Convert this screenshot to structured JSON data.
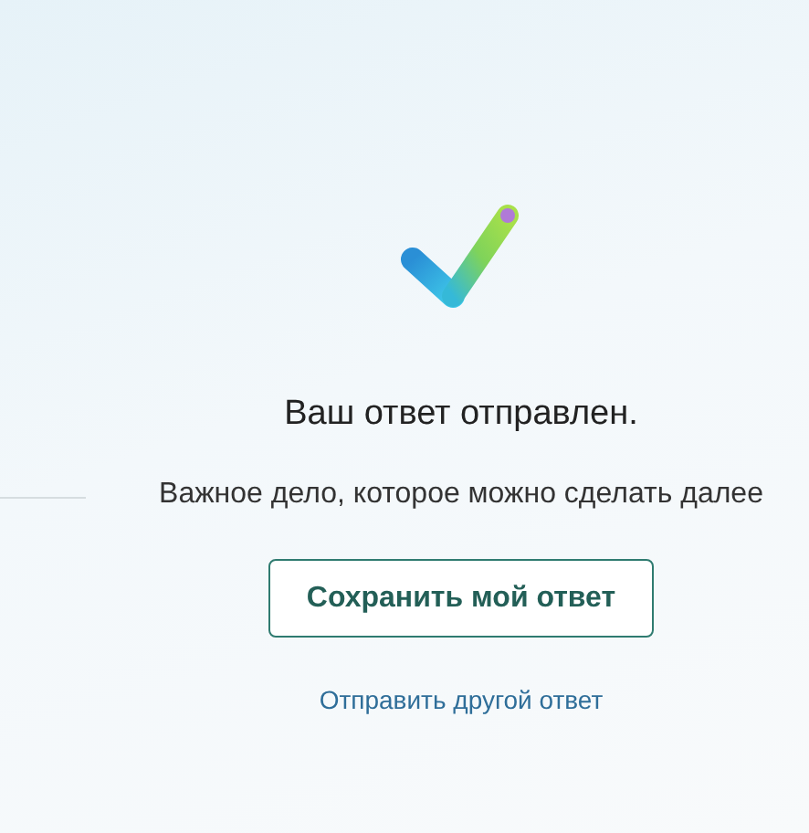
{
  "confirmation": {
    "title": "Ваш ответ отправлен.",
    "next_step": "Важное дело, которое можно сделать далее",
    "save_button": "Сохранить мой ответ",
    "another_link": "Отправить другой ответ"
  }
}
